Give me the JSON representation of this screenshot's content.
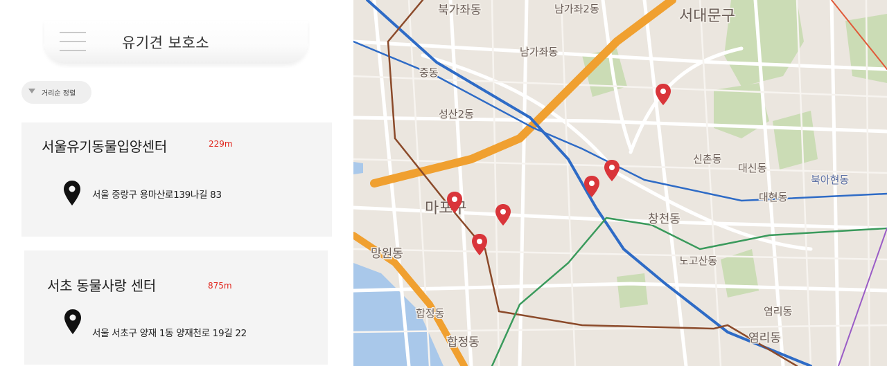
{
  "header": {
    "title": "유기견 보호소"
  },
  "sort": {
    "label": "거리순 정렬"
  },
  "shelters": [
    {
      "name": "서울유기동물입양센터",
      "distance": "229m",
      "address": "서울 중랑구 용마산로139나길 83"
    },
    {
      "name": "서초 동물사랑 센터",
      "distance": "875m",
      "address": "서울 서초구 양재 1동 양재천로 19길 22"
    }
  ],
  "map": {
    "labels": {
      "bukgajwa": "북가좌동",
      "namgajwa2": "남가좌2동",
      "seodaemun": "서대문구",
      "namgajwa": "남가좌동",
      "jungdong": "중동",
      "seongsan2": "성산2동",
      "sinchon": "신촌동",
      "daesin": "대신동",
      "bugahyeon": "북아현동",
      "daehyeon": "대현동",
      "mapogu": "마포구",
      "changcheon": "창천동",
      "mangwon": "망원동",
      "nogosan": "노고산동",
      "hapjeong_small": "합정동",
      "hapjeong": "합정동",
      "yeomni_small": "염리동",
      "yeomni": "염리동"
    },
    "colors": {
      "marker": "#d9353a",
      "expressway": "#f0a030",
      "river": "#a9c8ea",
      "park": "#c9ddb4",
      "metro_line2": "#3a9a5c",
      "metro_line6": "#8b4a2a",
      "metro_airport": "#2e6bc6"
    }
  }
}
